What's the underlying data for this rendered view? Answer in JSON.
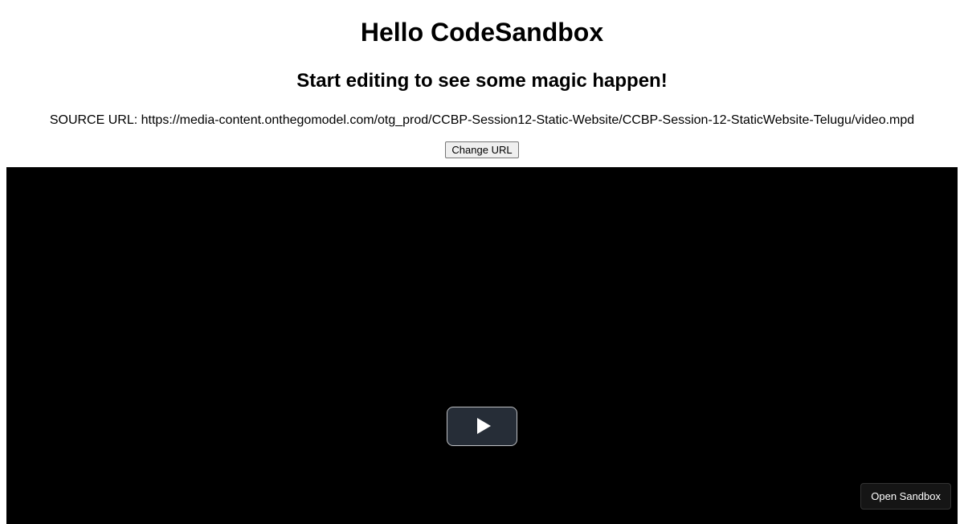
{
  "header": {
    "title": "Hello CodeSandbox",
    "subtitle": "Start editing to see some magic happen!"
  },
  "source": {
    "label_prefix": "SOURCE URL: ",
    "url": "https://media-content.onthegomodel.com/otg_prod/CCBP-Session12-Static-Website/CCBP-Session-12-StaticWebsite-Telugu/video.mpd"
  },
  "buttons": {
    "change_url": "Change URL",
    "open_sandbox": "Open Sandbox"
  }
}
